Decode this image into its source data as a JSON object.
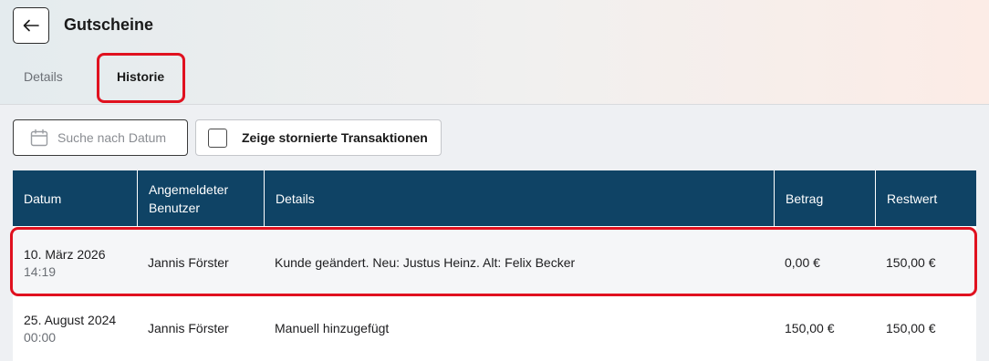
{
  "header": {
    "title": "Gutscheine",
    "back_icon": "arrow-left-icon"
  },
  "tabs": [
    {
      "label": "Details",
      "active": false
    },
    {
      "label": "Historie",
      "active": true
    }
  ],
  "toolbar": {
    "date_search_placeholder": "Suche nach Datum",
    "date_search_icon": "calendar-icon",
    "show_cancelled_label": "Zeige stornierte Transaktionen",
    "show_cancelled_checked": false
  },
  "table": {
    "columns": [
      "Datum",
      "Angemeldeter Benutzer",
      "Details",
      "Betrag",
      "Restwert"
    ],
    "rows": [
      {
        "date": "10. März 2026",
        "time": "14:19",
        "user": "Jannis Förster",
        "details": "Kunde geändert. Neu: Justus Heinz. Alt: Felix Becker",
        "amount": "0,00 €",
        "remaining": "150,00 €"
      },
      {
        "date": "25. August 2024",
        "time": "00:00",
        "user": "Jannis Förster",
        "details": "Manuell hinzugefügt",
        "amount": "150,00 €",
        "remaining": "150,00 €"
      }
    ]
  },
  "colors": {
    "header_bg": "#0f4365",
    "highlight": "#e0111f",
    "row_alt_bg": "#f5f6f8"
  }
}
